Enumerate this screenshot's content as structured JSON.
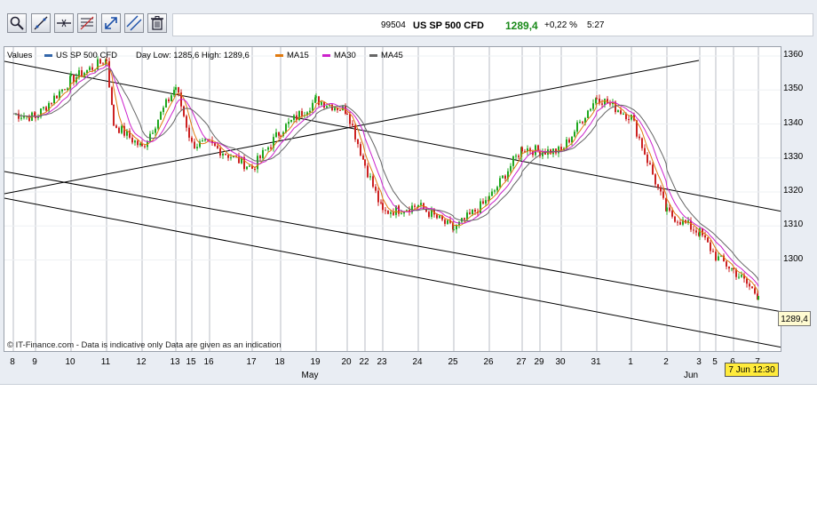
{
  "toolbar": {
    "tools": [
      {
        "name": "zoom-tool-button",
        "icon": "magnifier-icon"
      },
      {
        "name": "trendline-tool-button",
        "icon": "diagonal-line-icon"
      },
      {
        "name": "horizontal-line-tool-button",
        "icon": "horizontal-line-icon"
      },
      {
        "name": "fibonacci-tool-button",
        "icon": "fibonacci-icon"
      },
      {
        "name": "arrow-line-tool-button",
        "icon": "arrow-line-icon"
      },
      {
        "name": "parallel-channel-tool-button",
        "icon": "parallel-lines-icon"
      },
      {
        "name": "delete-drawings-button",
        "icon": "trash-icon"
      }
    ]
  },
  "quote": {
    "code": "99504",
    "name": "US SP 500 CFD",
    "price": "1289,4",
    "change": "+0,22 %",
    "time": "5:27",
    "price_color": "#1a8a1a"
  },
  "legend": {
    "values_label": "Values",
    "series_label": "US SP 500 CFD",
    "day_range": "Day Low: 1285,6  High: 1289,6",
    "ma15": "MA15",
    "ma30": "MA30",
    "ma45": "MA45",
    "colors": {
      "price": "#3366aa",
      "ma15": "#e07a10",
      "ma30": "#cc22cc",
      "ma45": "#666666"
    }
  },
  "watermark": "© IT-Finance.com - Data is indicative only Data are given as an indication",
  "last_price_badge": "1289,4",
  "time_badge": "7 Jun 12:30",
  "chart_data": {
    "type": "candlestick",
    "title": "US SP 500 CFD",
    "xlabel": "",
    "ylabel": "",
    "ylim": [
      1292,
      1367
    ],
    "y_ticks": [
      1300,
      1310,
      1320,
      1330,
      1340,
      1350,
      1360
    ],
    "x_ticks": [
      "8",
      "9",
      "10",
      "11",
      "12",
      "13",
      "15",
      "16",
      "17",
      "18",
      "19",
      "20",
      "22",
      "23",
      "24",
      "25",
      "26",
      "27",
      "29",
      "30",
      "31",
      "1",
      "2",
      "3",
      "5",
      "6",
      "7"
    ],
    "month_labels": [
      "May",
      "Jun"
    ],
    "grid": true,
    "legend": "top-left",
    "price_path": [
      {
        "x": "8",
        "y": 1343
      },
      {
        "x": "9",
        "y": 1342
      },
      {
        "x": "10",
        "y": 1353
      },
      {
        "x": "11",
        "y": 1359
      },
      {
        "x": "11",
        "y": 1340
      },
      {
        "x": "12",
        "y": 1333
      },
      {
        "x": "13",
        "y": 1351
      },
      {
        "x": "15",
        "y": 1334
      },
      {
        "x": "16",
        "y": 1334
      },
      {
        "x": "17",
        "y": 1327
      },
      {
        "x": "18",
        "y": 1338
      },
      {
        "x": "19",
        "y": 1347
      },
      {
        "x": "20",
        "y": 1344
      },
      {
        "x": "22",
        "y": 1328
      },
      {
        "x": "23",
        "y": 1314
      },
      {
        "x": "24",
        "y": 1316
      },
      {
        "x": "25",
        "y": 1309
      },
      {
        "x": "26",
        "y": 1318
      },
      {
        "x": "27",
        "y": 1333
      },
      {
        "x": "29",
        "y": 1332
      },
      {
        "x": "30",
        "y": 1332
      },
      {
        "x": "31",
        "y": 1348
      },
      {
        "x": "1",
        "y": 1342
      },
      {
        "x": "2",
        "y": 1314
      },
      {
        "x": "3",
        "y": 1308
      },
      {
        "x": "5",
        "y": 1301
      },
      {
        "x": "6",
        "y": 1297
      },
      {
        "x": "7",
        "y": 1289.4
      }
    ],
    "current_value": 1289.4
  }
}
